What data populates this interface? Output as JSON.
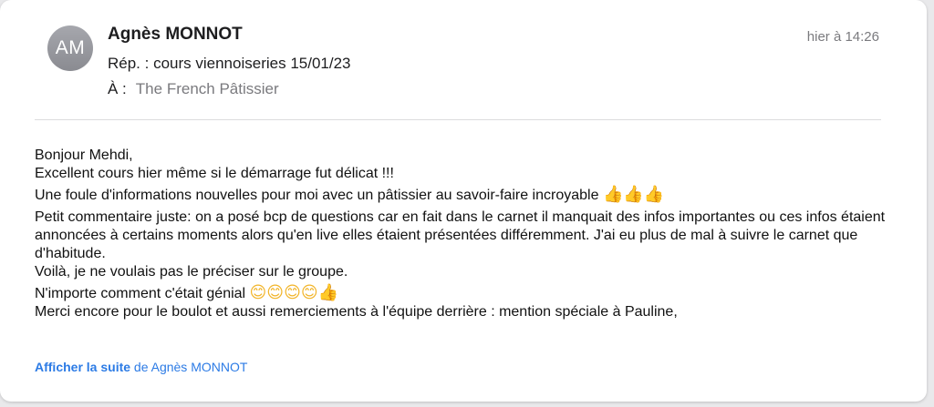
{
  "message": {
    "avatar_initials": "AM",
    "sender": "Agnès MONNOT",
    "date": "hier à 14:26",
    "subject": "Rép. : cours viennoiseries 15/01/23",
    "to_label": "À :",
    "to_value": "The French Pâtissier"
  },
  "body": {
    "line1": "Bonjour Mehdi,",
    "line2": "Excellent cours hier même si le démarrage fut délicat !!!",
    "line3": "Une foule d'informations nouvelles pour moi avec un pâtissier au savoir-faire incroyable",
    "line3_emoji": "👍👍👍",
    "line4": "Petit commentaire juste: on a posé bcp de questions car en fait dans le carnet il manquait des infos importantes ou ces infos étaient annoncées à certains moments alors qu'en live elles étaient présentées différemment. J'ai eu plus de mal à suivre le carnet que d'habitude.",
    "line5": "Voilà, je ne voulais pas le préciser sur le groupe.",
    "line6": "N'importe comment c'était génial",
    "line6_emoji_smiles": "😊😊😊😊",
    "line6_emoji_thumb": "👍",
    "line7": "Merci encore pour le boulot et aussi remerciements à l'équipe derrière : mention spéciale à Pauline,"
  },
  "footer": {
    "show_more_label": "Afficher la suite",
    "show_more_suffix": "de Agnès MONNOT"
  },
  "colors": {
    "accent_link": "#2c7be5",
    "avatar_bg": "#8a8b91",
    "secondary_text": "#7a7a7e"
  }
}
